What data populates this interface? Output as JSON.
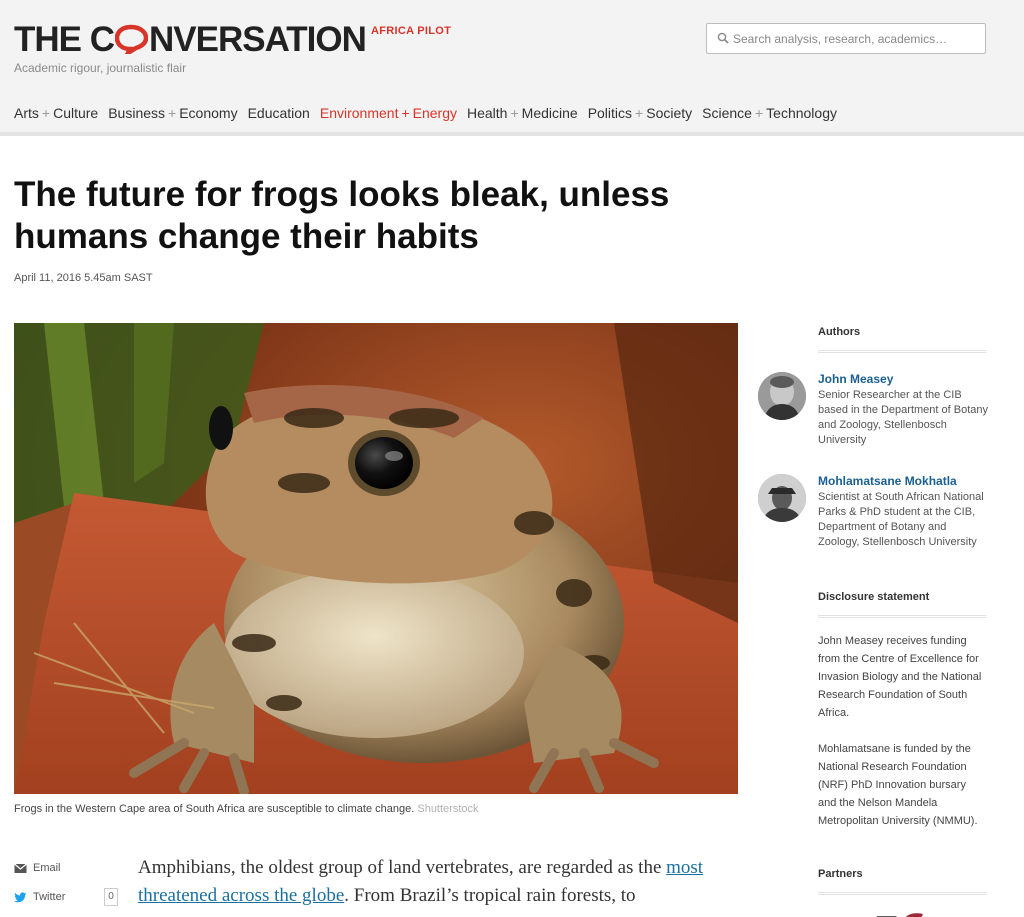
{
  "header": {
    "logo_pre": "THE C",
    "logo_post": "NVERSATION",
    "edition": "AFRICA PILOT",
    "tagline": "Academic rigour, journalistic flair",
    "search_placeholder": "Search analysis, research, academics…"
  },
  "nav": [
    {
      "a": "Arts",
      "b": "Culture"
    },
    {
      "a": "Business",
      "b": "Economy"
    },
    {
      "a": "Education",
      "b": ""
    },
    {
      "a": "Environment",
      "b": "Energy",
      "active": true
    },
    {
      "a": "Health",
      "b": "Medicine"
    },
    {
      "a": "Politics",
      "b": "Society"
    },
    {
      "a": "Science",
      "b": "Technology"
    }
  ],
  "colors": {
    "brand_red": "#d8352a",
    "link_blue": "#1a6fa0"
  },
  "article": {
    "title": "The future for frogs looks bleak, unless humans change their habits",
    "date": "April 11, 2016 5.45am SAST",
    "caption": "Frogs in the Western Cape area of South Africa are susceptible to climate change.",
    "credit": "Shutterstock",
    "body_pre": "Amphibians, the oldest group of land vertebrates, are regarded as the",
    "body_link": "most threatened across the globe",
    "body_post": ". From Brazil’s tropical rain forests, to"
  },
  "share": {
    "email": "Email",
    "twitter": "Twitter",
    "twitter_count": "0"
  },
  "sidebar": {
    "authors_heading": "Authors",
    "authors": [
      {
        "name": "John Measey",
        "role": "Senior Researcher at the CIB based in the Department of Botany and Zoology, Stellenbosch University"
      },
      {
        "name": "Mohlamatsane Mokhatla",
        "role": "Scientist at South African National Parks & PhD student at the CIB, Department of Botany and Zoology, Stellenbosch University"
      }
    ],
    "disclosure_heading": "Disclosure statement",
    "disclosure": [
      "John Measey receives funding from the Centre of Excellence for Invasion Biology and the National Research Foundation of South Africa.",
      "Mohlamatsane is funded by the National Research Foundation (NRF) PhD Innovation bursary and the Nelson Mandela Metropolitan University (NMMU)."
    ],
    "partners_heading": "Partners"
  }
}
